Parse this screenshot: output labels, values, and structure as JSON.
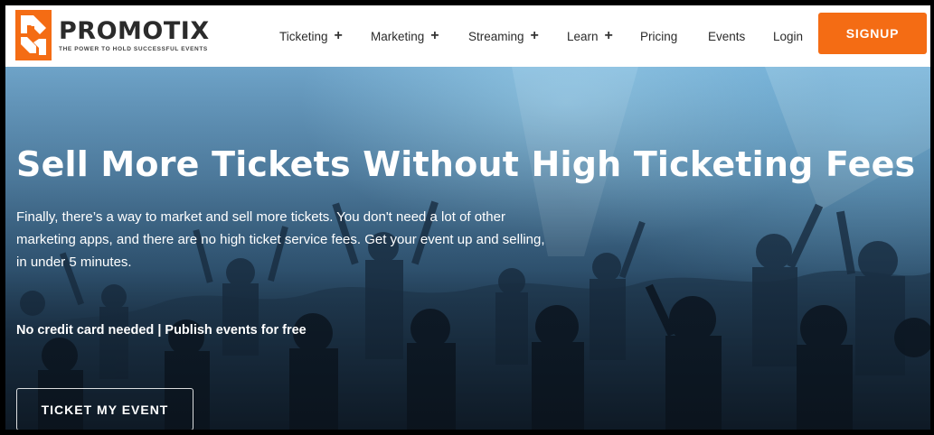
{
  "brand": {
    "name": "PROMOTIX",
    "tagline": "THE POWER TO HOLD SUCCESSFUL EVENTS",
    "logo_icon": "promotix-logo-mark",
    "accent_color": "#f46c14"
  },
  "nav": {
    "items": [
      {
        "label": "Ticketing",
        "expand": "+"
      },
      {
        "label": "Marketing",
        "expand": "+"
      },
      {
        "label": "Streaming",
        "expand": "+"
      },
      {
        "label": "Learn",
        "expand": "+"
      },
      {
        "label": "Pricing"
      },
      {
        "label": "Events"
      },
      {
        "label": "Login"
      }
    ],
    "signup_label": "SIGNUP"
  },
  "hero": {
    "title": "Sell More Tickets Without High Ticketing Fees",
    "description": "Finally, there’s a way to market and sell more tickets. You don't need a lot of other marketing apps, and there are no high ticket service fees. Get your event up and selling, in under 5 minutes.",
    "note": "No credit card needed | Publish events for free",
    "cta_label": "TICKET MY EVENT",
    "background": "concert-crowd-image"
  }
}
